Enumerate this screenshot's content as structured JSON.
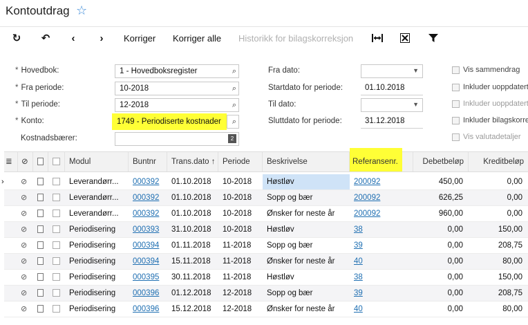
{
  "window": {
    "title": "Kontoutdrag"
  },
  "toolbar": {
    "refresh_label": "C",
    "korriger": "Korriger",
    "korriger_alle": "Korriger alle",
    "historikk": "Historikk for bilagskorreksjon"
  },
  "form": {
    "hovedbok": {
      "label": "Hovedbok:",
      "value": "1 - Hovedboksregister"
    },
    "fra_periode": {
      "label": "Fra periode:",
      "value": "10-2018"
    },
    "til_periode": {
      "label": "Til periode:",
      "value": "12-2018"
    },
    "konto": {
      "label": "Konto:",
      "value": "1749 - Periodiserte kostnader"
    },
    "kostnadsbaerer": {
      "label": "Kostnadsbærer:",
      "value": ""
    },
    "fra_dato": {
      "label": "Fra dato:",
      "value": ""
    },
    "startdato": {
      "label": "Startdato for periode:",
      "value": "01.10.2018"
    },
    "til_dato": {
      "label": "Til dato:",
      "value": ""
    },
    "sluttdato": {
      "label": "Sluttdato for periode:",
      "value": "31.12.2018"
    },
    "checkboxes": [
      {
        "label": "Vis sammendrag",
        "disabled": false
      },
      {
        "label": "Inkluder uoppdaterte",
        "disabled": false
      },
      {
        "label": "Inkluder uoppdaterte",
        "disabled": true
      },
      {
        "label": "Inkluder bilagskorre",
        "disabled": false
      },
      {
        "label": "Vis valutadetaljer",
        "disabled": true
      }
    ]
  },
  "grid": {
    "columns": {
      "modul": "Modul",
      "buntnr": "Buntnr",
      "transdato": "Trans.dato ↑",
      "periode": "Periode",
      "beskrivelse": "Beskrivelse",
      "referanse": "Referansenr.",
      "debet": "Debetbeløp",
      "kredit": "Kreditbeløp"
    },
    "rows": [
      {
        "modul": "Leverandørr...",
        "buntnr": "000392",
        "dato": "01.10.2018",
        "periode": "10-2018",
        "beskrivelse": "Høstløv",
        "ref": "200092",
        "debet": "450,00",
        "kredit": "0,00"
      },
      {
        "modul": "Leverandørr...",
        "buntnr": "000392",
        "dato": "01.10.2018",
        "periode": "10-2018",
        "beskrivelse": "Sopp og bær",
        "ref": "200092",
        "debet": "626,25",
        "kredit": "0,00"
      },
      {
        "modul": "Leverandørr...",
        "buntnr": "000392",
        "dato": "01.10.2018",
        "periode": "10-2018",
        "beskrivelse": "Ønsker for neste år",
        "ref": "200092",
        "debet": "960,00",
        "kredit": "0,00"
      },
      {
        "modul": "Periodisering",
        "buntnr": "000393",
        "dato": "31.10.2018",
        "periode": "10-2018",
        "beskrivelse": "Høstløv",
        "ref": "38",
        "debet": "0,00",
        "kredit": "150,00"
      },
      {
        "modul": "Periodisering",
        "buntnr": "000394",
        "dato": "01.11.2018",
        "periode": "11-2018",
        "beskrivelse": "Sopp og bær",
        "ref": "39",
        "debet": "0,00",
        "kredit": "208,75"
      },
      {
        "modul": "Periodisering",
        "buntnr": "000394",
        "dato": "15.11.2018",
        "periode": "11-2018",
        "beskrivelse": "Ønsker for neste år",
        "ref": "40",
        "debet": "0,00",
        "kredit": "80,00"
      },
      {
        "modul": "Periodisering",
        "buntnr": "000395",
        "dato": "30.11.2018",
        "periode": "11-2018",
        "beskrivelse": "Høstløv",
        "ref": "38",
        "debet": "0,00",
        "kredit": "150,00"
      },
      {
        "modul": "Periodisering",
        "buntnr": "000396",
        "dato": "01.12.2018",
        "periode": "12-2018",
        "beskrivelse": "Sopp og bær",
        "ref": "39",
        "debet": "0,00",
        "kredit": "208,75"
      },
      {
        "modul": "Periodisering",
        "buntnr": "000396",
        "dato": "15.12.2018",
        "periode": "12-2018",
        "beskrivelse": "Ønsker for neste år",
        "ref": "40",
        "debet": "0,00",
        "kredit": "80,00"
      }
    ]
  },
  "colors": {
    "highlight": "#ffff36",
    "link": "#1f6fb2",
    "selected": "#cfe3f7",
    "star": "#3b8ad8"
  }
}
